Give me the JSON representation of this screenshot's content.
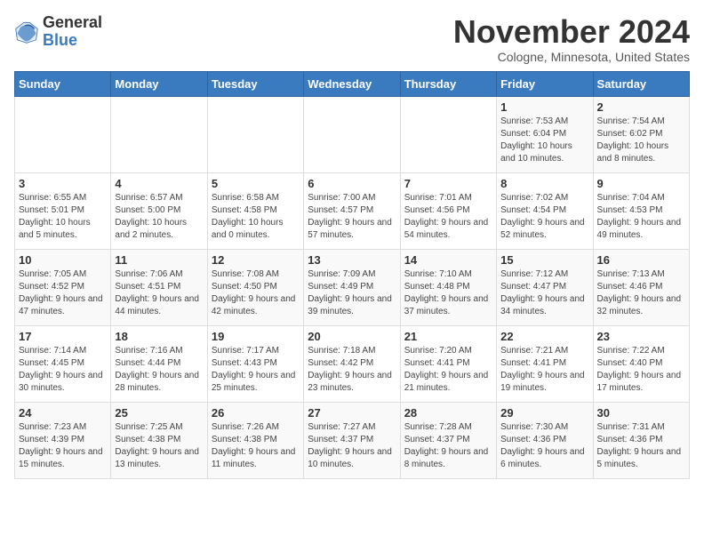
{
  "header": {
    "logo_general": "General",
    "logo_blue": "Blue",
    "month_title": "November 2024",
    "subtitle": "Cologne, Minnesota, United States"
  },
  "days_of_week": [
    "Sunday",
    "Monday",
    "Tuesday",
    "Wednesday",
    "Thursday",
    "Friday",
    "Saturday"
  ],
  "weeks": [
    [
      {
        "day": "",
        "info": ""
      },
      {
        "day": "",
        "info": ""
      },
      {
        "day": "",
        "info": ""
      },
      {
        "day": "",
        "info": ""
      },
      {
        "day": "",
        "info": ""
      },
      {
        "day": "1",
        "info": "Sunrise: 7:53 AM\nSunset: 6:04 PM\nDaylight: 10 hours and 10 minutes."
      },
      {
        "day": "2",
        "info": "Sunrise: 7:54 AM\nSunset: 6:02 PM\nDaylight: 10 hours and 8 minutes."
      }
    ],
    [
      {
        "day": "3",
        "info": "Sunrise: 6:55 AM\nSunset: 5:01 PM\nDaylight: 10 hours and 5 minutes."
      },
      {
        "day": "4",
        "info": "Sunrise: 6:57 AM\nSunset: 5:00 PM\nDaylight: 10 hours and 2 minutes."
      },
      {
        "day": "5",
        "info": "Sunrise: 6:58 AM\nSunset: 4:58 PM\nDaylight: 10 hours and 0 minutes."
      },
      {
        "day": "6",
        "info": "Sunrise: 7:00 AM\nSunset: 4:57 PM\nDaylight: 9 hours and 57 minutes."
      },
      {
        "day": "7",
        "info": "Sunrise: 7:01 AM\nSunset: 4:56 PM\nDaylight: 9 hours and 54 minutes."
      },
      {
        "day": "8",
        "info": "Sunrise: 7:02 AM\nSunset: 4:54 PM\nDaylight: 9 hours and 52 minutes."
      },
      {
        "day": "9",
        "info": "Sunrise: 7:04 AM\nSunset: 4:53 PM\nDaylight: 9 hours and 49 minutes."
      }
    ],
    [
      {
        "day": "10",
        "info": "Sunrise: 7:05 AM\nSunset: 4:52 PM\nDaylight: 9 hours and 47 minutes."
      },
      {
        "day": "11",
        "info": "Sunrise: 7:06 AM\nSunset: 4:51 PM\nDaylight: 9 hours and 44 minutes."
      },
      {
        "day": "12",
        "info": "Sunrise: 7:08 AM\nSunset: 4:50 PM\nDaylight: 9 hours and 42 minutes."
      },
      {
        "day": "13",
        "info": "Sunrise: 7:09 AM\nSunset: 4:49 PM\nDaylight: 9 hours and 39 minutes."
      },
      {
        "day": "14",
        "info": "Sunrise: 7:10 AM\nSunset: 4:48 PM\nDaylight: 9 hours and 37 minutes."
      },
      {
        "day": "15",
        "info": "Sunrise: 7:12 AM\nSunset: 4:47 PM\nDaylight: 9 hours and 34 minutes."
      },
      {
        "day": "16",
        "info": "Sunrise: 7:13 AM\nSunset: 4:46 PM\nDaylight: 9 hours and 32 minutes."
      }
    ],
    [
      {
        "day": "17",
        "info": "Sunrise: 7:14 AM\nSunset: 4:45 PM\nDaylight: 9 hours and 30 minutes."
      },
      {
        "day": "18",
        "info": "Sunrise: 7:16 AM\nSunset: 4:44 PM\nDaylight: 9 hours and 28 minutes."
      },
      {
        "day": "19",
        "info": "Sunrise: 7:17 AM\nSunset: 4:43 PM\nDaylight: 9 hours and 25 minutes."
      },
      {
        "day": "20",
        "info": "Sunrise: 7:18 AM\nSunset: 4:42 PM\nDaylight: 9 hours and 23 minutes."
      },
      {
        "day": "21",
        "info": "Sunrise: 7:20 AM\nSunset: 4:41 PM\nDaylight: 9 hours and 21 minutes."
      },
      {
        "day": "22",
        "info": "Sunrise: 7:21 AM\nSunset: 4:41 PM\nDaylight: 9 hours and 19 minutes."
      },
      {
        "day": "23",
        "info": "Sunrise: 7:22 AM\nSunset: 4:40 PM\nDaylight: 9 hours and 17 minutes."
      }
    ],
    [
      {
        "day": "24",
        "info": "Sunrise: 7:23 AM\nSunset: 4:39 PM\nDaylight: 9 hours and 15 minutes."
      },
      {
        "day": "25",
        "info": "Sunrise: 7:25 AM\nSunset: 4:38 PM\nDaylight: 9 hours and 13 minutes."
      },
      {
        "day": "26",
        "info": "Sunrise: 7:26 AM\nSunset: 4:38 PM\nDaylight: 9 hours and 11 minutes."
      },
      {
        "day": "27",
        "info": "Sunrise: 7:27 AM\nSunset: 4:37 PM\nDaylight: 9 hours and 10 minutes."
      },
      {
        "day": "28",
        "info": "Sunrise: 7:28 AM\nSunset: 4:37 PM\nDaylight: 9 hours and 8 minutes."
      },
      {
        "day": "29",
        "info": "Sunrise: 7:30 AM\nSunset: 4:36 PM\nDaylight: 9 hours and 6 minutes."
      },
      {
        "day": "30",
        "info": "Sunrise: 7:31 AM\nSunset: 4:36 PM\nDaylight: 9 hours and 5 minutes."
      }
    ]
  ]
}
